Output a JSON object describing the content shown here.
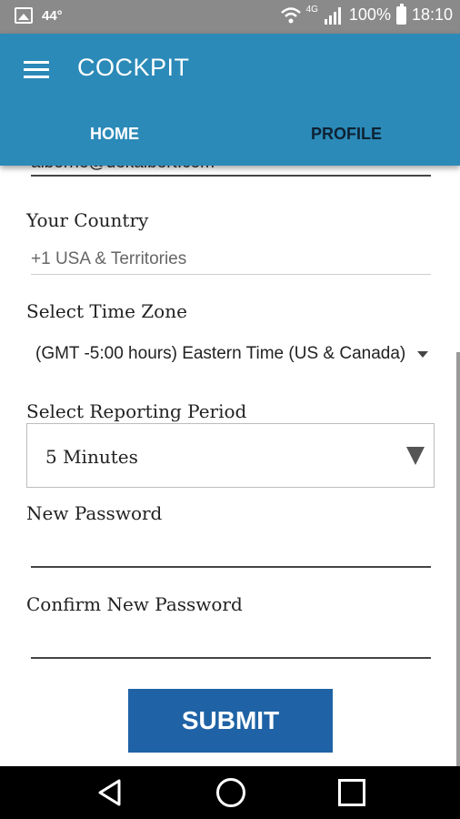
{
  "status_bar": {
    "temperature": "44°",
    "network": "4G",
    "battery": "100%",
    "time": "18:10"
  },
  "app_bar": {
    "title": "COCKPIT",
    "tabs": [
      {
        "label": "HOME",
        "active": true
      },
      {
        "label": "PROFILE",
        "active": false
      }
    ],
    "color": "#2b8ab8"
  },
  "form": {
    "email_value": "alborne@dekalbert.com",
    "country": {
      "label": "Your Country",
      "value": "+1 USA & Territories"
    },
    "time_zone": {
      "label": "Select Time Zone",
      "value": "(GMT -5:00 hours) Eastern Time (US & Canada)"
    },
    "reporting_period": {
      "label": "Select Reporting Period",
      "value": "5 Minutes"
    },
    "new_password": {
      "label": "New Password",
      "value": ""
    },
    "confirm_password": {
      "label": "Confirm New Password",
      "value": ""
    },
    "submit_label": "SUBMIT",
    "submit_color": "#1f63a6"
  },
  "nav_bar": {
    "icons": [
      "back-icon",
      "home-icon",
      "recent-apps-icon"
    ]
  }
}
